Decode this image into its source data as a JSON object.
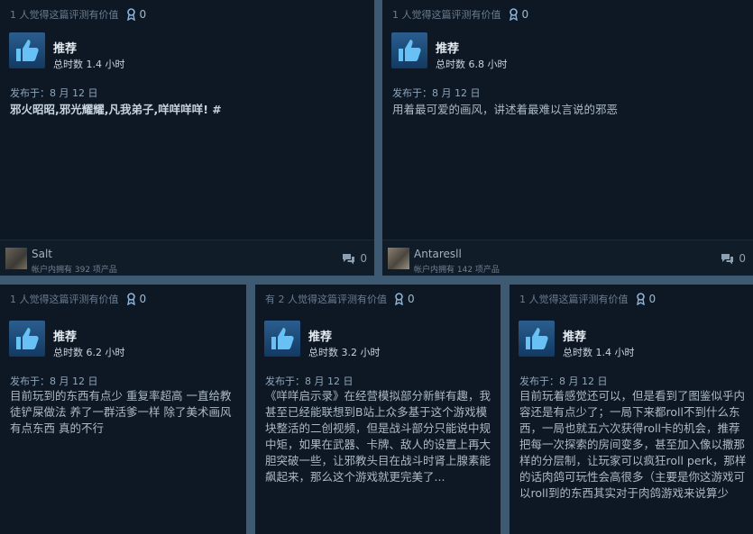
{
  "reviews": [
    {
      "helpful": "1 人觉得这篇评测有价值",
      "awards": "0",
      "recommend": "推荐",
      "hours": "总时数 1.4 小时",
      "posted": "发布于：8 月 12 日",
      "text": "邪火昭昭,邪光耀耀,凡我弟子,咩咩咩咩! #",
      "username": "Salt",
      "owned": "帐户内拥有 392 项产品",
      "comments": "0"
    },
    {
      "helpful": "1 人觉得这篇评测有价值",
      "awards": "0",
      "recommend": "推荐",
      "hours": "总时数 6.8 小时",
      "posted": "发布于：8 月 12 日",
      "text": "用着最可爱的画风，讲述着最难以言说的邪恶",
      "username": "Antaresll",
      "owned": "帐户内拥有 142 项产品",
      "comments": "0"
    },
    {
      "helpful": "1 人觉得这篇评测有价值",
      "awards": "0",
      "recommend": "推荐",
      "hours": "总时数 6.2 小时",
      "posted": "发布于：8 月 12 日",
      "text": "目前玩到的东西有点少 重复率超高 一直给教徒铲屎做法 养了一群活爹一样 除了美术画风有点东西 真的不行"
    },
    {
      "helpful": "有 2 人觉得这篇评测有价值",
      "awards": "0",
      "recommend": "推荐",
      "hours": "总时数 3.2 小时",
      "posted": "发布于：8 月 12 日",
      "text": "《咩咩启示录》在经营模拟部分新鲜有趣，我甚至已经能联想到B站上众多基于这个游戏模块整活的二创视频，但是战斗部分只能说中规中矩，如果在武器、卡牌、敌人的设置上再大胆突破一些，让邪教头目在战斗时肾上腺素能飙起来，那么这个游戏就更完美了..."
    },
    {
      "helpful": "1 人觉得这篇评测有价值",
      "awards": "0",
      "recommend": "推荐",
      "hours": "总时数 1.4 小时",
      "posted": "发布于：8 月 12 日",
      "text": "目前玩着感觉还可以，但是看到了图鉴似乎内容还是有点少了；一局下来都roll不到什么东西，一局也就五六次获得roll卡的机会，推荐把每一次探索的房间变多，甚至加入像以撒那样的分层制，让玩家可以疯狂roll perk，那样的话肉鸽可玩性会高很多（主要是你这游戏可以roll到的东西其实对于肉鸽游戏来说算少"
    }
  ],
  "colors": {
    "background": "#3e5a73",
    "card": "#0e1825",
    "award": "#9fb9d0",
    "thumb": "#2a5d8e"
  },
  "icons": [
    "award-ribbon-icon",
    "thumbs-up-icon",
    "comment-bubble-icon"
  ]
}
